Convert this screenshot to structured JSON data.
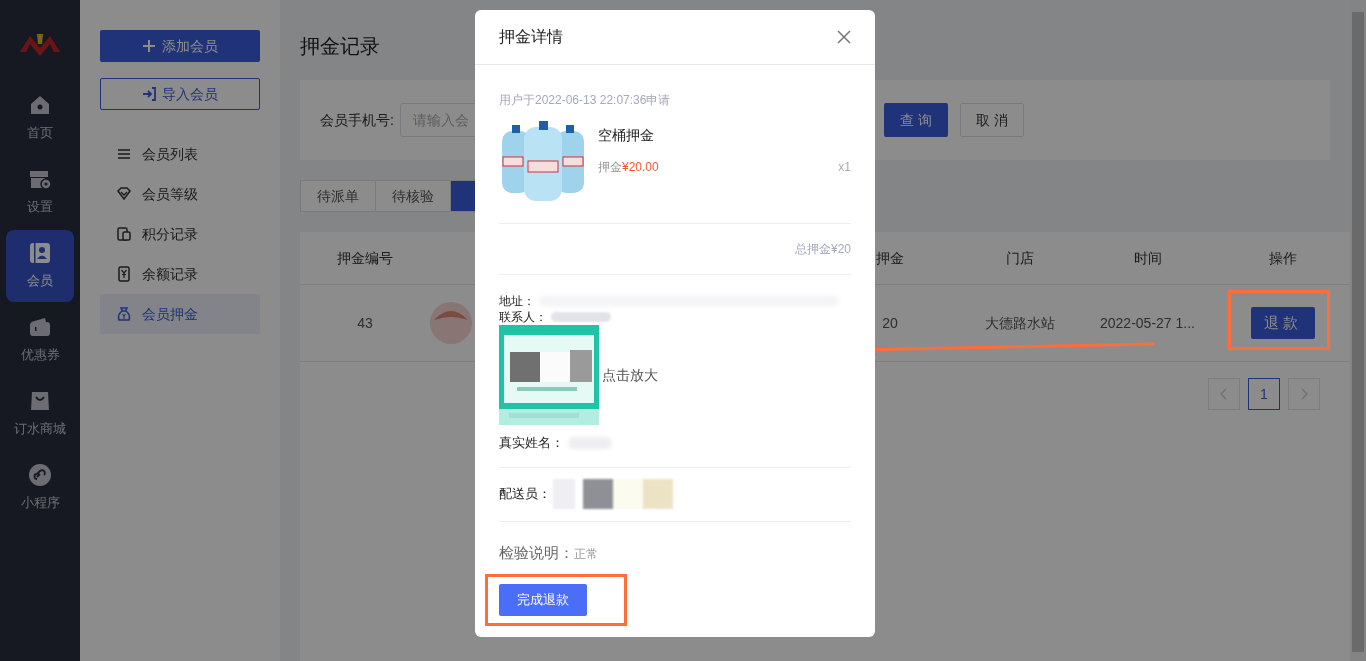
{
  "nav_rail": {
    "items": [
      {
        "label": "首页",
        "selected": false
      },
      {
        "label": "设置",
        "selected": false
      },
      {
        "label": "会员",
        "selected": true
      },
      {
        "label": "优惠券",
        "selected": false
      },
      {
        "label": "订水商城",
        "selected": false
      },
      {
        "label": "小程序",
        "selected": false
      }
    ]
  },
  "member_menu": {
    "buttons": [
      {
        "label": "添加会员",
        "kind": "primary"
      },
      {
        "label": "导入会员",
        "kind": "outline"
      }
    ],
    "items": [
      {
        "label": "会员列表",
        "selected": false
      },
      {
        "label": "会员等级",
        "selected": false
      },
      {
        "label": "积分记录",
        "selected": false
      },
      {
        "label": "余额记录",
        "selected": false
      },
      {
        "label": "会员押金",
        "selected": true
      }
    ]
  },
  "page_title": "押金记录",
  "search": {
    "label": "会员手机号:",
    "placeholder": "请输入会",
    "buttons": [
      {
        "label": "查 询",
        "kind": "primary"
      },
      {
        "label": "取 消",
        "kind": "default"
      }
    ]
  },
  "tabs": [
    {
      "label": "待派单",
      "selected": false
    },
    {
      "label": "待核验",
      "selected": false
    },
    {
      "selected": true
    }
  ],
  "table": {
    "columns": [
      "押金编号",
      "",
      "",
      "押金",
      "门店",
      "时间",
      "操作"
    ],
    "rows": [
      {
        "id": "43",
        "deposit": "20",
        "store": "大德路水站",
        "time": "2022-05-27 1...",
        "action": "退款"
      }
    ]
  },
  "pagination": {
    "pages": [
      {
        "label": "1",
        "selected": true
      }
    ]
  },
  "dialog": {
    "title": "押金详情",
    "applied": "用户于2022-06-13 22:07:36申请",
    "product": {
      "name": "空桶押金",
      "price_label": "押金",
      "price": "¥20.00",
      "qty": "x1"
    },
    "total": "总押金¥20",
    "address_label": "地址：",
    "contact_label": "联系人：",
    "zoom_hint": "点击放大",
    "realname_label": "真实姓名：",
    "courier_label": "配送员：",
    "note_label": "检验说明：",
    "note": "正常",
    "confirm": "完成退款"
  }
}
